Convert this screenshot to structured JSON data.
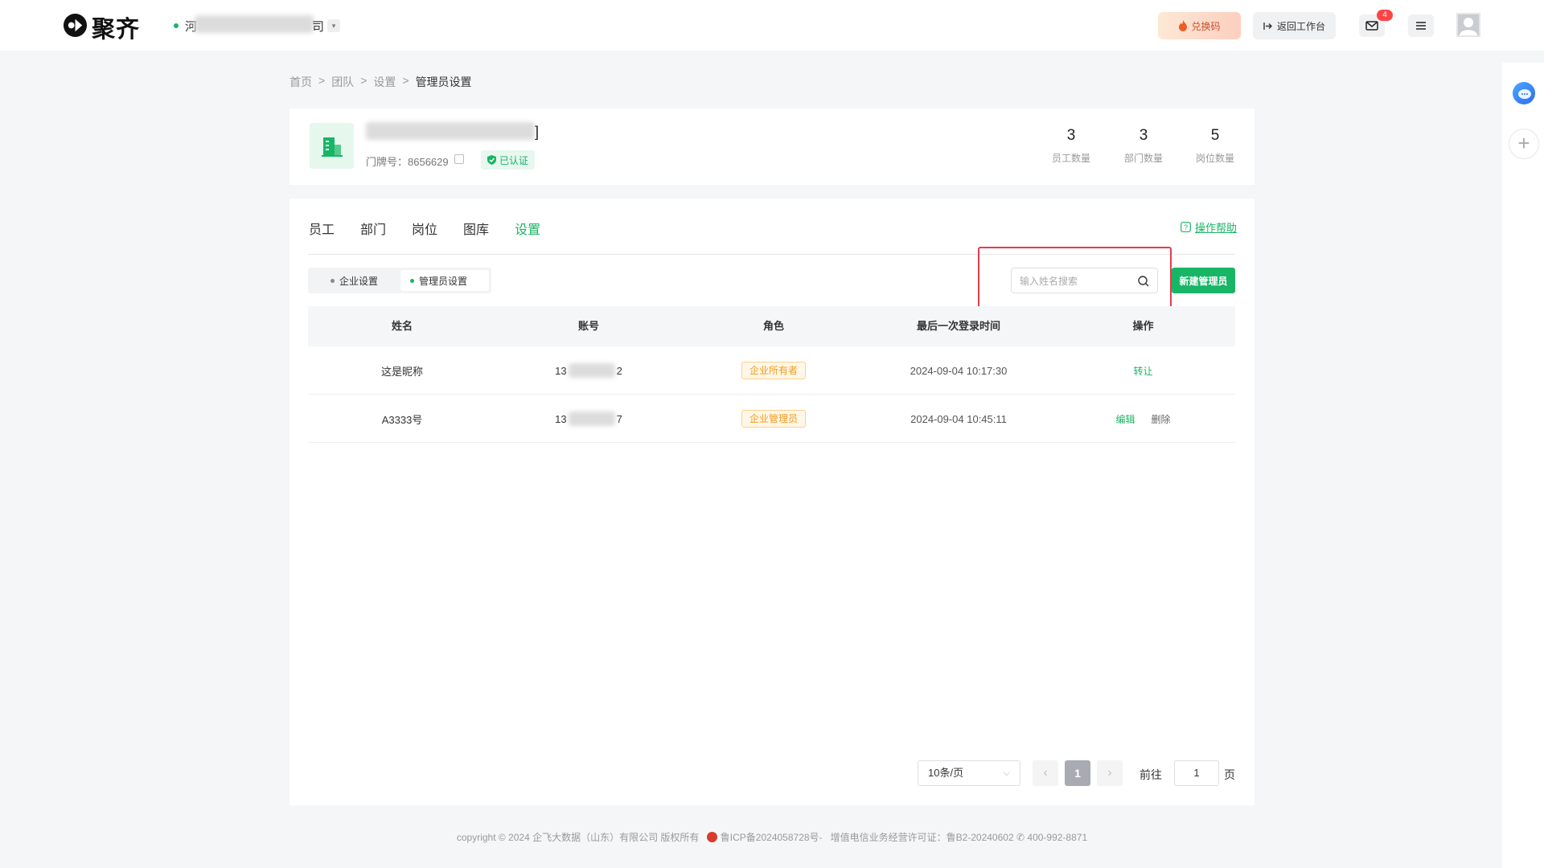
{
  "header": {
    "logo_text": "聚齐",
    "org_name_first": "河",
    "org_name_last": "司",
    "org_caret": "▾",
    "redeem_label": "兑换码",
    "back_label": "返回工作台",
    "mail_badge": "4"
  },
  "breadcrumb": [
    "首页",
    "团队",
    "设置",
    "管理员设置"
  ],
  "org": {
    "title_end": "]",
    "door_number": "门牌号：8656629",
    "verified": "已认证",
    "stats": [
      {
        "value": "3",
        "label": "员工数量"
      },
      {
        "value": "3",
        "label": "部门数量"
      },
      {
        "value": "5",
        "label": "岗位数量"
      }
    ]
  },
  "tabs": [
    "员工",
    "部门",
    "岗位",
    "图库",
    "设置"
  ],
  "help_label": "操作帮助",
  "subtabs": [
    "企业设置",
    "管理员设置"
  ],
  "search": {
    "placeholder": "输入姓名搜索"
  },
  "add_button": "新建管理员",
  "table": {
    "columns": [
      "姓名",
      "账号",
      "角色",
      "最后一次登录时间",
      "操作"
    ],
    "rows": [
      {
        "name": "这是昵称",
        "acct_prefix": "13",
        "acct_suffix": "2",
        "role": "企业所有者",
        "last_login": "2024-09-04 10:17:30",
        "actions": [
          "转让"
        ]
      },
      {
        "name": "A3333号",
        "acct_prefix": "13",
        "acct_suffix": "7",
        "role": "企业管理员",
        "last_login": "2024-09-04 10:45:11",
        "actions": [
          "编辑",
          "删除"
        ]
      }
    ]
  },
  "pagination": {
    "page_size": "10条/页",
    "prev": "‹",
    "current": "1",
    "next": "›",
    "goto_label": "前往",
    "goto_value": "1",
    "page_word": "页"
  },
  "footer": {
    "copyright": "copyright © 2024 企飞大数据（山东）有限公司 版权所有",
    "icp": "鲁ICP备2024058728号-",
    "license": "增值电信业务经营许可证：鲁B2-20240602",
    "phone": "400-992-8871"
  },
  "colors": {
    "accent": "#18b566",
    "warning": "#f59a1b",
    "highlight": "#e83a4d"
  }
}
